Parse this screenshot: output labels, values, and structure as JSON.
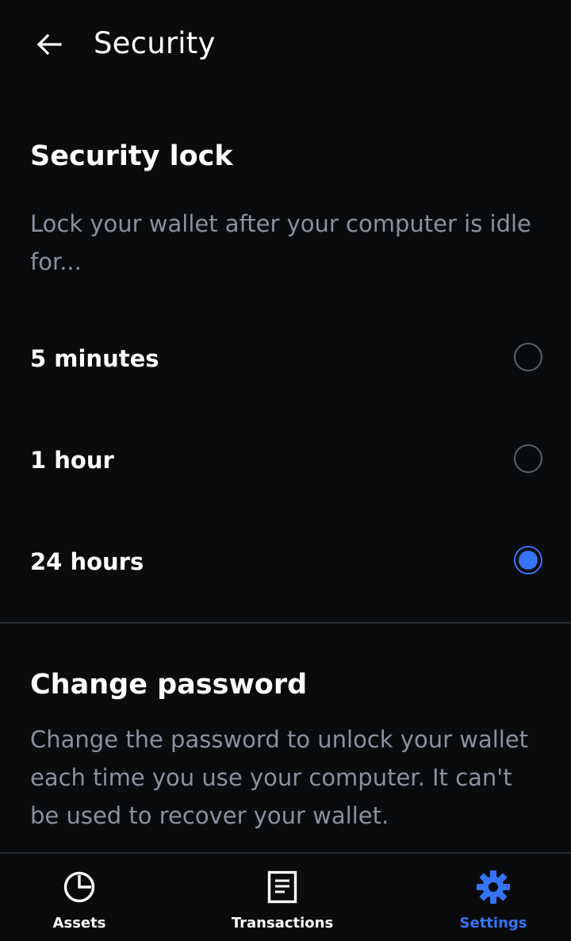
{
  "header": {
    "title": "Security"
  },
  "security_lock": {
    "title": "Security lock",
    "description": "Lock your wallet after your computer is idle for...",
    "options": [
      {
        "label": "5 minutes",
        "selected": false
      },
      {
        "label": "1 hour",
        "selected": false
      },
      {
        "label": "24 hours",
        "selected": true
      }
    ]
  },
  "change_password": {
    "title": "Change password",
    "description": "Change the password to unlock your wallet each time you use your computer. It can't be used to recover your wallet."
  },
  "bottom_nav": {
    "items": [
      {
        "label": "Assets",
        "icon": "pie-chart-icon",
        "active": false
      },
      {
        "label": "Transactions",
        "icon": "document-icon",
        "active": false
      },
      {
        "label": "Settings",
        "icon": "gear-icon",
        "active": true
      }
    ]
  },
  "colors": {
    "background": "#0a0b0d",
    "accent": "#3773f5",
    "text_primary": "#ffffff",
    "text_secondary": "#8a919e",
    "divider": "#2a2d33"
  }
}
